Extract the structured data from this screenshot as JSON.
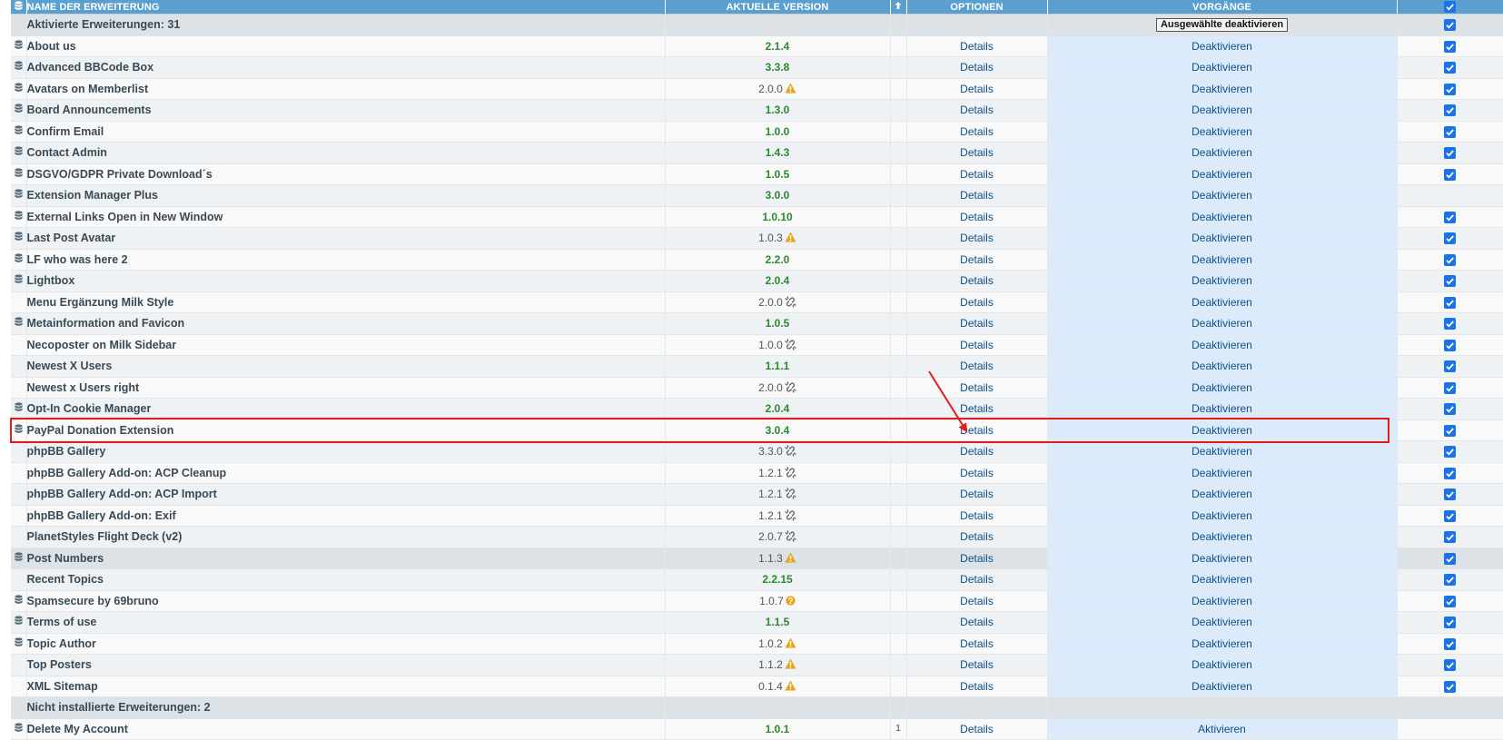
{
  "header": {
    "name": "NAME DER ERWEITERUNG",
    "version": "AKTUELLE VERSION",
    "options": "OPTIONEN",
    "actions": "VORGÄNGE"
  },
  "sections": {
    "enabled": {
      "title": "Aktivierte Erweiterungen: 31",
      "bulk_button": "Ausgewählte deaktivieren"
    },
    "not_installed": {
      "title": "Nicht installierte Erweiterungen: 2"
    }
  },
  "labels": {
    "details": "Details",
    "deactivate": "Deaktivieren",
    "activate": "Aktivieren"
  },
  "rows": [
    {
      "name": "About us",
      "version": "2.1.4",
      "status": "current",
      "db": true,
      "checked": true
    },
    {
      "name": "Advanced BBCode Box",
      "version": "3.3.8",
      "status": "current",
      "db": true,
      "checked": true
    },
    {
      "name": "Avatars on Memberlist",
      "version": "2.0.0",
      "status": "warning",
      "db": true,
      "checked": true
    },
    {
      "name": "Board Announcements",
      "version": "1.3.0",
      "status": "current",
      "db": true,
      "checked": true
    },
    {
      "name": "Confirm Email",
      "version": "1.0.0",
      "status": "current",
      "db": true,
      "checked": true
    },
    {
      "name": "Contact Admin",
      "version": "1.4.3",
      "status": "current",
      "db": true,
      "checked": true
    },
    {
      "name": "DSGVO/GDPR Private Download´s",
      "version": "1.0.5",
      "status": "current",
      "db": true,
      "checked": true
    },
    {
      "name": "Extension Manager Plus",
      "version": "3.0.0",
      "status": "current",
      "db": true,
      "checked": false
    },
    {
      "name": "External Links Open in New Window",
      "version": "1.0.10",
      "status": "current",
      "db": true,
      "checked": true
    },
    {
      "name": "Last Post Avatar",
      "version": "1.0.3",
      "status": "warning",
      "db": true,
      "checked": true
    },
    {
      "name": "LF who was here 2",
      "version": "2.2.0",
      "status": "current",
      "db": true,
      "checked": true
    },
    {
      "name": "Lightbox",
      "version": "2.0.4",
      "status": "current",
      "db": true,
      "checked": true
    },
    {
      "name": "Menu Ergänzung Milk Style",
      "version": "2.0.0",
      "status": "unlinked",
      "db": false,
      "checked": true
    },
    {
      "name": "Metainformation and Favicon",
      "version": "1.0.5",
      "status": "current",
      "db": true,
      "checked": true
    },
    {
      "name": "Necoposter on Milk Sidebar",
      "version": "1.0.0",
      "status": "unlinked",
      "db": false,
      "checked": true
    },
    {
      "name": "Newest X Users",
      "version": "1.1.1",
      "status": "current",
      "db": false,
      "checked": true
    },
    {
      "name": "Newest x Users right",
      "version": "2.0.0",
      "status": "unlinked",
      "db": false,
      "checked": true
    },
    {
      "name": "Opt-In Cookie Manager",
      "version": "2.0.4",
      "status": "current",
      "db": true,
      "checked": true
    },
    {
      "name": "PayPal Donation Extension",
      "version": "3.0.4",
      "status": "current",
      "db": true,
      "checked": true
    },
    {
      "name": "phpBB Gallery",
      "version": "3.3.0",
      "status": "unlinked",
      "db": false,
      "checked": true
    },
    {
      "name": "phpBB Gallery Add-on: ACP Cleanup",
      "version": "1.2.1",
      "status": "unlinked",
      "db": false,
      "checked": true
    },
    {
      "name": "phpBB Gallery Add-on: ACP Import",
      "version": "1.2.1",
      "status": "unlinked",
      "db": false,
      "checked": true
    },
    {
      "name": "phpBB Gallery Add-on: Exif",
      "version": "1.2.1",
      "status": "unlinked",
      "db": false,
      "checked": true
    },
    {
      "name": "PlanetStyles Flight Deck (v2)",
      "version": "2.0.7",
      "status": "unlinked",
      "db": false,
      "checked": true
    },
    {
      "name": "Post Numbers",
      "version": "1.1.3",
      "status": "warning",
      "db": true,
      "checked": true,
      "shaded": true
    },
    {
      "name": "Recent Topics",
      "version": "2.2.15",
      "status": "current",
      "db": false,
      "checked": true
    },
    {
      "name": "Spamsecure by 69bruno",
      "version": "1.0.7",
      "status": "unknown",
      "db": true,
      "checked": true
    },
    {
      "name": "Terms of use",
      "version": "1.1.5",
      "status": "current",
      "db": true,
      "checked": true
    },
    {
      "name": "Topic Author",
      "version": "1.0.2",
      "status": "warning",
      "db": true,
      "checked": true
    },
    {
      "name": "Top Posters",
      "version": "1.1.2",
      "status": "warning",
      "db": false,
      "checked": true
    },
    {
      "name": "XML Sitemap",
      "version": "0.1.4",
      "status": "warning",
      "db": false,
      "checked": true
    }
  ],
  "not_installed_rows": [
    {
      "name": "Delete My Account",
      "version": "1.0.1",
      "status": "current",
      "db": true,
      "sort": "1"
    }
  ],
  "colors": {
    "header_bg": "#5a9fd0",
    "version_current": "#2b8a2b",
    "warning": "#e8a317",
    "link": "#0d4f86",
    "action_cell": "#dcebfb",
    "checkbox": "#1a73e8",
    "annotation": "#e21b1b"
  },
  "icons": {
    "database": "database-icon",
    "warning": "warning-icon",
    "unlinked": "unlink-icon",
    "unknown": "question-icon",
    "sort": "arrow-up-icon",
    "check": "checkbox-icon"
  },
  "annotation": {
    "highlighted_row": "phpBB Gallery"
  }
}
